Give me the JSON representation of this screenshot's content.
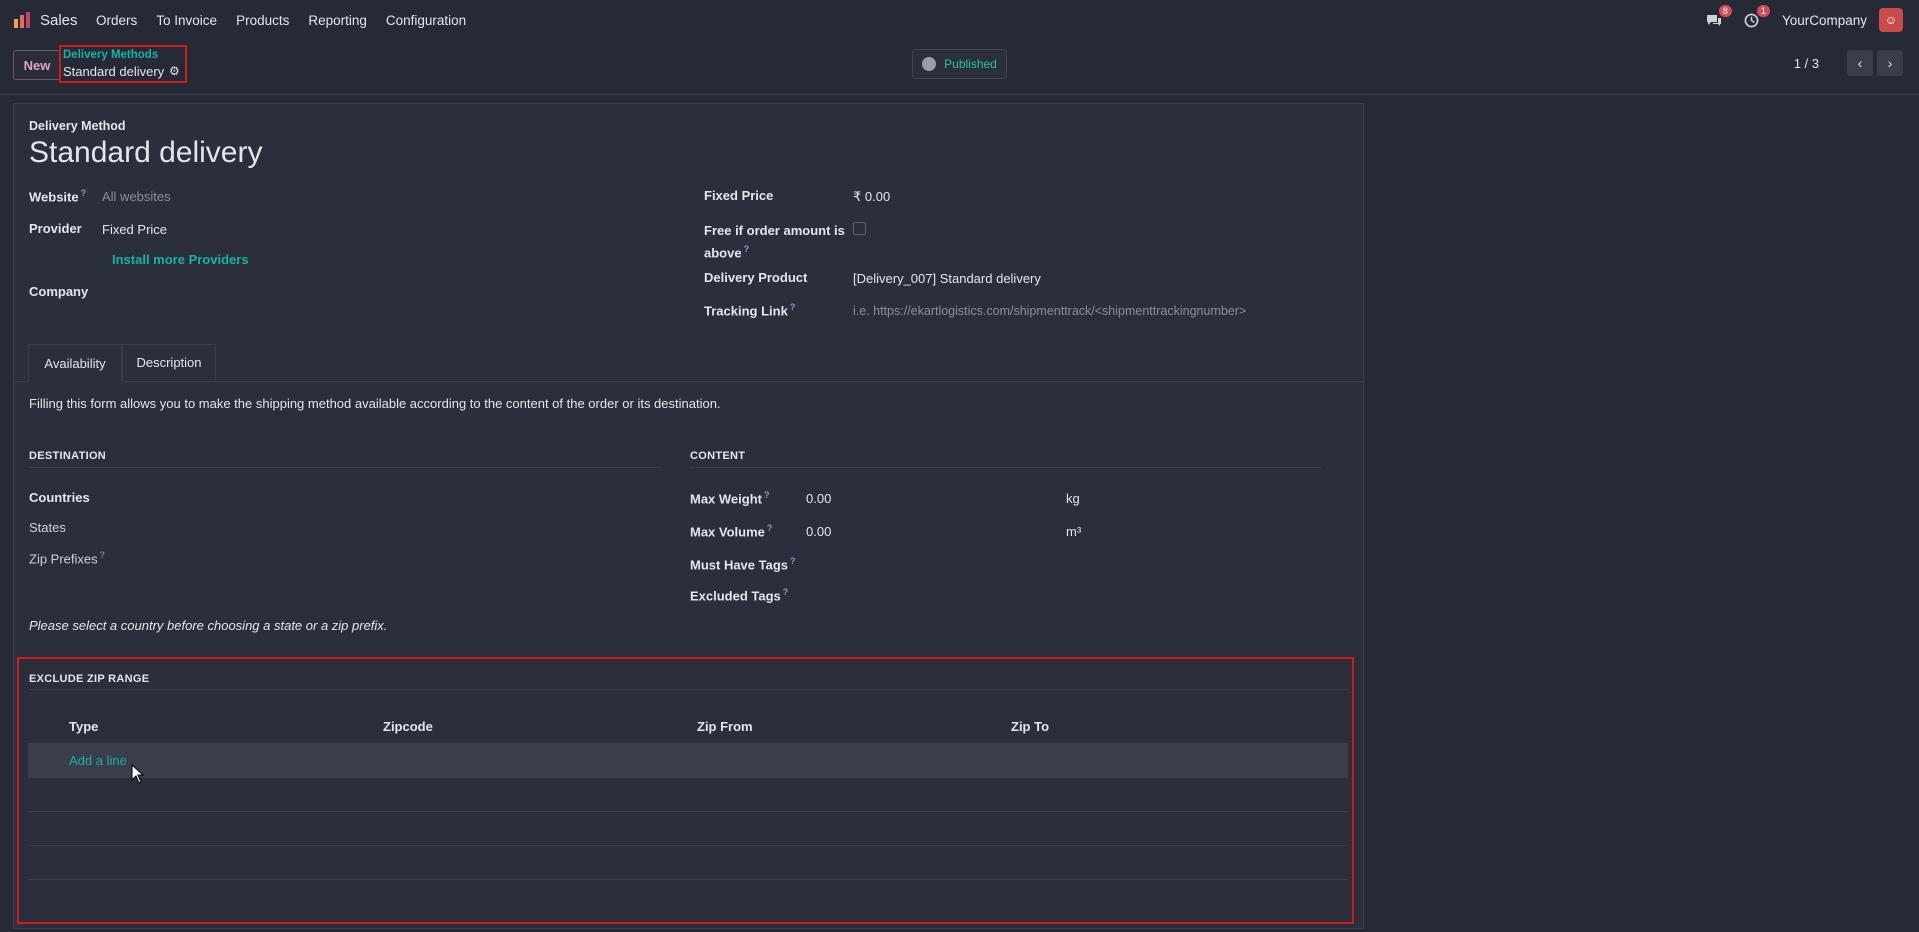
{
  "topbar": {
    "app_name": "Sales",
    "menu": [
      "Orders",
      "To Invoice",
      "Products",
      "Reporting",
      "Configuration"
    ],
    "messages_badge": "8",
    "activities_badge": "1",
    "company": "YourCompany"
  },
  "control": {
    "new_label": "New",
    "breadcrumb_parent": "Delivery Methods",
    "breadcrumb_current": "Standard delivery",
    "published_label": "Published",
    "pager": "1 / 3"
  },
  "form": {
    "heading_label": "Delivery Method",
    "name": "Standard delivery",
    "website_label": "Website",
    "website_placeholder": "All websites",
    "provider_label": "Provider",
    "provider_value": "Fixed Price",
    "install_providers": "Install more Providers",
    "company_label": "Company",
    "fixed_price_label": "Fixed Price",
    "fixed_price_value": "₹ 0.00",
    "free_above_label_1": "Free if order amount is",
    "free_above_label_2": "above",
    "delivery_product_label": "Delivery Product",
    "delivery_product_value": "[Delivery_007] Standard delivery",
    "tracking_link_label": "Tracking Link",
    "tracking_link_placeholder": "i.e. https://ekartlogistics.com/shipmenttrack/<shipmenttrackingnumber>"
  },
  "tabs": [
    "Availability",
    "Description"
  ],
  "availability": {
    "intro": "Filling this form allows you to make the shipping method available according to the content of the order or its destination.",
    "destination_title": "DESTINATION",
    "countries_label": "Countries",
    "states_label": "States",
    "zip_prefixes_label": "Zip Prefixes",
    "note": "Please select a country before choosing a state or a zip prefix.",
    "content_title": "CONTENT",
    "max_weight_label": "Max Weight",
    "max_weight_value": "0.00",
    "weight_unit": "kg",
    "max_volume_label": "Max Volume",
    "max_volume_value": "0.00",
    "volume_unit": "m³",
    "must_have_tags_label": "Must Have Tags",
    "excluded_tags_label": "Excluded Tags"
  },
  "exclude_zip": {
    "title": "EXCLUDE ZIP RANGE",
    "columns": [
      "Type",
      "Zipcode",
      "Zip From",
      "Zip To"
    ],
    "add_line": "Add a line"
  },
  "colors": {
    "accent": "#17b2a3",
    "highlight_box": "#d11a1a",
    "published": "#28c98c"
  }
}
